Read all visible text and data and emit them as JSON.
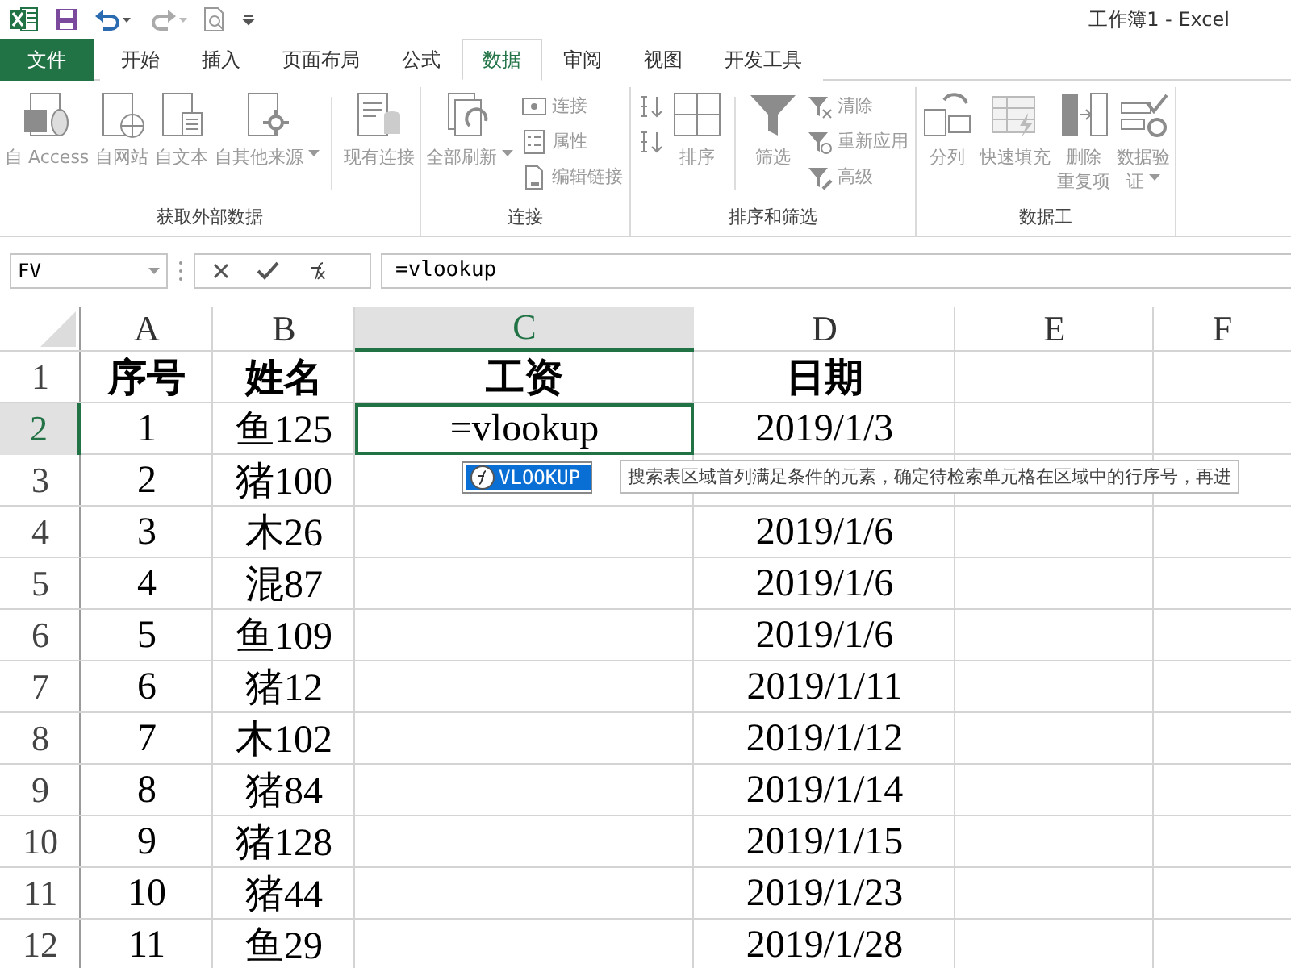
{
  "window": {
    "title": "工作簿1 - Excel"
  },
  "tabs": [
    {
      "label": "文件",
      "kind": "file",
      "selected": false
    },
    {
      "label": "开始",
      "kind": "tab",
      "selected": false
    },
    {
      "label": "插入",
      "kind": "tab",
      "selected": false
    },
    {
      "label": "页面布局",
      "kind": "tab",
      "selected": false
    },
    {
      "label": "公式",
      "kind": "tab",
      "selected": false
    },
    {
      "label": "数据",
      "kind": "tab",
      "selected": true
    },
    {
      "label": "审阅",
      "kind": "tab",
      "selected": false
    },
    {
      "label": "视图",
      "kind": "tab",
      "selected": false
    },
    {
      "label": "开发工具",
      "kind": "tab",
      "selected": false
    }
  ],
  "ribbon": {
    "groups": [
      {
        "label": "获取外部数据",
        "items": [
          {
            "kind": "large",
            "lines": [
              "自 Access"
            ],
            "caret": false,
            "disabled": true
          },
          {
            "kind": "large",
            "lines": [
              "自网站"
            ],
            "caret": false,
            "disabled": true
          },
          {
            "kind": "large",
            "lines": [
              "自文本"
            ],
            "caret": false,
            "disabled": true
          },
          {
            "kind": "large",
            "lines": [
              "自其他来源"
            ],
            "caret": true,
            "disabled": true
          },
          {
            "kind": "separator"
          },
          {
            "kind": "large",
            "lines": [
              "现有连接"
            ],
            "caret": false,
            "disabled": true
          }
        ]
      },
      {
        "label": "连接",
        "items": [
          {
            "kind": "large",
            "lines": [
              "全部刷新"
            ],
            "caret": true,
            "disabled": true
          },
          {
            "kind": "stack",
            "commands": [
              {
                "label": "连接",
                "disabled": true
              },
              {
                "label": "属性",
                "disabled": true
              },
              {
                "label": "编辑链接",
                "disabled": true
              }
            ]
          }
        ]
      },
      {
        "label": "排序和筛选",
        "items": [
          {
            "kind": "stack",
            "commands": [
              {
                "disabled": true
              },
              {
                "disabled": true
              }
            ]
          },
          {
            "kind": "large",
            "lines": [
              "排序"
            ],
            "caret": false,
            "disabled": true
          },
          {
            "kind": "separator"
          },
          {
            "kind": "large",
            "lines": [
              "筛选"
            ],
            "caret": false,
            "disabled": true
          },
          {
            "kind": "stack",
            "commands": [
              {
                "label": "清除",
                "disabled": true
              },
              {
                "label": "重新应用",
                "disabled": true
              },
              {
                "label": "高级",
                "disabled": true
              }
            ]
          }
        ]
      },
      {
        "label": "数据工",
        "items": [
          {
            "kind": "large",
            "lines": [
              "分列"
            ],
            "caret": false,
            "disabled": true
          },
          {
            "kind": "large",
            "lines": [
              "快速填充"
            ],
            "caret": false,
            "disabled": true
          },
          {
            "kind": "large",
            "lines": [
              "删除",
              "重复项"
            ],
            "caret": false,
            "disabled": true
          },
          {
            "kind": "large",
            "lines": [
              "数据验",
              "证"
            ],
            "caret": true,
            "disabled": true
          }
        ]
      }
    ]
  },
  "formula_bar": {
    "name_box": "FV",
    "formula": "=vlookup"
  },
  "sheet": {
    "columns": [
      {
        "label": "A",
        "selected": false
      },
      {
        "label": "B",
        "selected": false
      },
      {
        "label": "C",
        "selected": true
      },
      {
        "label": "D",
        "selected": false
      },
      {
        "label": "E",
        "selected": false
      },
      {
        "label": "F",
        "selected": false
      }
    ],
    "rows": [
      {
        "header": "1",
        "selected": false,
        "bold": true,
        "cells": [
          "序号",
          "姓名",
          "工资",
          "日期"
        ]
      },
      {
        "header": "2",
        "selected": true,
        "bold": false,
        "cells": [
          "1",
          "鱼125",
          "=vlookup",
          "2019/1/3"
        ]
      },
      {
        "header": "3",
        "selected": false,
        "bold": false,
        "cells": [
          "2",
          "猪100",
          null,
          null
        ]
      },
      {
        "header": "4",
        "selected": false,
        "bold": false,
        "cells": [
          "3",
          "木26",
          null,
          "2019/1/6"
        ]
      },
      {
        "header": "5",
        "selected": false,
        "bold": false,
        "cells": [
          "4",
          "混87",
          null,
          "2019/1/6"
        ]
      },
      {
        "header": "6",
        "selected": false,
        "bold": false,
        "cells": [
          "5",
          "鱼109",
          null,
          "2019/1/6"
        ]
      },
      {
        "header": "7",
        "selected": false,
        "bold": false,
        "cells": [
          "6",
          "猪12",
          null,
          "2019/1/11"
        ]
      },
      {
        "header": "8",
        "selected": false,
        "bold": false,
        "cells": [
          "7",
          "木102",
          null,
          "2019/1/12"
        ]
      },
      {
        "header": "9",
        "selected": false,
        "bold": false,
        "cells": [
          "8",
          "猪84",
          null,
          "2019/1/14"
        ]
      },
      {
        "header": "10",
        "selected": false,
        "bold": false,
        "cells": [
          "9",
          "猪128",
          null,
          "2019/1/15"
        ]
      },
      {
        "header": "11",
        "selected": false,
        "bold": false,
        "cells": [
          "10",
          "猪44",
          null,
          "2019/1/23"
        ]
      },
      {
        "header": "12",
        "selected": false,
        "bold": false,
        "cells": [
          "11",
          "鱼29",
          null,
          "2019/1/28"
        ]
      }
    ],
    "autocomplete": {
      "items": [
        {
          "label": "VLOOKUP",
          "selected": true
        }
      ],
      "tooltip": "搜索表区域首列满足条件的元素，确定待检索单元格在区域中的行序号，再进"
    }
  }
}
